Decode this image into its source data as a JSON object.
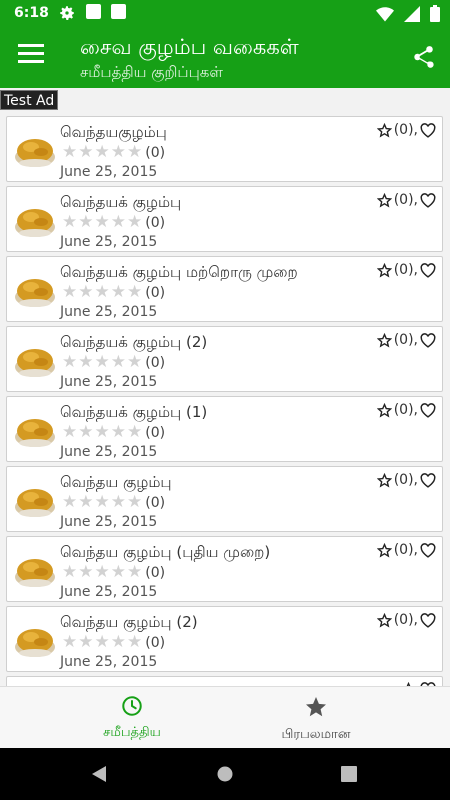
{
  "status_bar": {
    "time": "6:18"
  },
  "app_bar": {
    "title": "சைவ குழம்ப வகைகள்",
    "subtitle": "சமீபத்திய குறிப்புகள்"
  },
  "test_ad": "Test Ad",
  "recipes": [
    {
      "title": "வெந்தயகுழம்பு",
      "rating_count": "(0)",
      "date": "June 25, 2015",
      "favorites": "(0),"
    },
    {
      "title": "வெந்தயக் குழம்பு",
      "rating_count": "(0)",
      "date": "June 25, 2015",
      "favorites": "(0),"
    },
    {
      "title": "வெந்தயக் குழம்பு மற்றொரு முறை",
      "rating_count": "(0)",
      "date": "June 25, 2015",
      "favorites": "(0),"
    },
    {
      "title": "வெந்தயக் குழம்பு (2)",
      "rating_count": "(0)",
      "date": "June 25, 2015",
      "favorites": "(0),"
    },
    {
      "title": "வெந்தயக் குழம்பு (1)",
      "rating_count": "(0)",
      "date": "June 25, 2015",
      "favorites": "(0),"
    },
    {
      "title": "வெந்தய குழம்பு",
      "rating_count": "(0)",
      "date": "June 25, 2015",
      "favorites": "(0),"
    },
    {
      "title": "வெந்தய குழம்பு (புதிய முறை)",
      "rating_count": "(0)",
      "date": "June 25, 2015",
      "favorites": "(0),"
    },
    {
      "title": "வெந்தய குழம்பு (2)",
      "rating_count": "(0)",
      "date": "June 25, 2015",
      "favorites": "(0),"
    },
    {
      "title": "",
      "rating_count": "",
      "date": "",
      "favorites": ""
    }
  ],
  "bottom_nav": {
    "recent": {
      "label": "சமீபத்திய",
      "icon": "clock-icon"
    },
    "popular": {
      "label": "பிரபலமான",
      "icon": "star-icon"
    }
  },
  "colors": {
    "primary": "#16a016",
    "star_empty": "#d2d2d2"
  }
}
